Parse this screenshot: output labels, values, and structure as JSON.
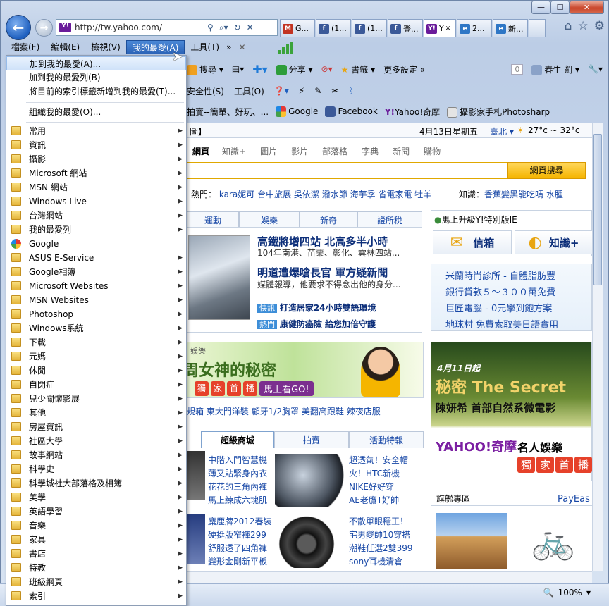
{
  "browser": {
    "url": "http://tw.yahoo.com/",
    "tabs": [
      "G...",
      "(1...",
      "(1...",
      "登...",
      "Y",
      "2...",
      "新..."
    ],
    "menu": [
      "檔案(F)",
      "編輯(E)",
      "檢視(V)",
      "我的最愛(A)",
      "工具(T)"
    ]
  },
  "toolbar1": {
    "search": "搜尋",
    "share": "分享",
    "bookmarks": "書籤",
    "more": "更多設定",
    "count": "0",
    "user": "春生 劉"
  },
  "toolbar2": {
    "safety": "安全性(S)",
    "tools": "工具(O)"
  },
  "favbar": {
    "items": [
      "拍賣--簡單、好玩、...",
      "Google",
      "Facebook",
      "Yahoo!奇摩",
      "攝影家手札Photosharp"
    ]
  },
  "favmenu": {
    "top": [
      "加到我的最愛(A)...",
      "加到我的最愛列(B)",
      "將目前的索引標籤新增到我的最愛(T)...",
      "組織我的最愛(O)..."
    ],
    "folders": [
      "常用",
      "資訊",
      "攝影",
      "Microsoft 網站",
      "MSN 網站",
      "Windows Live",
      "台灣網站",
      "我的最愛列",
      "Google",
      "ASUS E-Service",
      "Google相簿",
      "Microsoft Websites",
      "MSN Websites",
      "Photoshop",
      "Windows系統",
      "下載",
      "元媽",
      "休閒",
      "自閉症",
      "兒少關懷影展",
      "其他",
      "房屋資訊",
      "社區大學",
      "故事網站",
      "科學史",
      "科學城社大部落格及相簿",
      "美學",
      "英語學習",
      "音樂",
      "家具",
      "書店",
      "特教",
      "班級網頁",
      "索引"
    ]
  },
  "page": {
    "topbar": {
      "left": "圖】",
      "date": "4月13日星期五",
      "city": "臺北",
      "weather": "27°c ~ 32°c"
    },
    "searchtabs": [
      "網頁",
      "知識+",
      "圖片",
      "影片",
      "部落格",
      "字典",
      "新聞",
      "購物"
    ],
    "searchbtn": "網頁搜尋",
    "hot": {
      "label": "熱門：",
      "items": [
        "kara妮可",
        "台中旅展",
        "吳依潔",
        "潑水節",
        "海芋季",
        "省電家電",
        "牡羊"
      ],
      "know_label": "知識：",
      "know": [
        "香蕉變黑能吃嗎",
        "水腫"
      ]
    },
    "newstabs": [
      "運動",
      "娛樂",
      "新奇",
      "證所稅"
    ],
    "news": [
      {
        "h": "高鐵將增四站 北高多半小時",
        "s": "104年南港、苗栗、彰化、雲林四站..."
      },
      {
        "h": "明道遭爆嗆長官 軍方疑新聞",
        "s": "媒體報導，他要求不得念出他的身分..."
      }
    ],
    "quick": [
      {
        "tag": "快訊",
        "t": "打造居家24小時雙語環境"
      },
      {
        "tag": "熱門",
        "t": "康健防癌險 給您加倍守護"
      }
    ],
    "rightpanel": {
      "upgrade": "馬上升級Y!特別版IE",
      "mail": "信箱",
      "know": "知識+",
      "ads": [
        "米蘭時尚診所 - 自體脂肪豐",
        "銀行貸款５～３００萬免費",
        "巨匠電腦 - 0元學到飽方案",
        "地球村 免費索取美日語實用"
      ]
    },
    "banner": {
      "tag": "娛樂",
      "title": "周女神的秘密",
      "chips": [
        "獨",
        "家",
        "首",
        "播"
      ],
      "go": "馬上看GO!"
    },
    "links": [
      "規箱",
      "東大門洋裝",
      "顧牙1/2胸罩",
      "美翻高跟鞋",
      "辣夜店服"
    ],
    "shoptabs": [
      "超級商城",
      "拍賣",
      "活動特報"
    ],
    "shop": [
      [
        "中階入門智慧機",
        "薄又貼緊身內衣",
        "花花的三角內褲",
        "馬上練成六塊肌"
      ],
      [
        "超透氣！安全帽",
        "火！HTC新機",
        "NIKE好好穿",
        "AE老鷹T好帥"
      ],
      [
        "麋鹿牌2012春裝",
        "硬挺版窄褲299",
        "舒服透了四角褲",
        "變形金剛新平板"
      ],
      [
        "不散單眼穩王！",
        "宅男變帥10穿搭",
        "潮鞋任選2雙399",
        "sony耳機清倉"
      ]
    ],
    "ad": {
      "date": "4月11日起",
      "title": "秘密 The Secret",
      "sub": "陳妍希 首部自然系微電影",
      "brand": "YAHOO!奇摩",
      "brand2": "名人娛樂",
      "chips": [
        "獨",
        "家",
        "首",
        "播"
      ]
    },
    "flagship": "旗艦專區",
    "payeasy": "PayEas"
  },
  "status": {
    "zoom": "100%"
  }
}
